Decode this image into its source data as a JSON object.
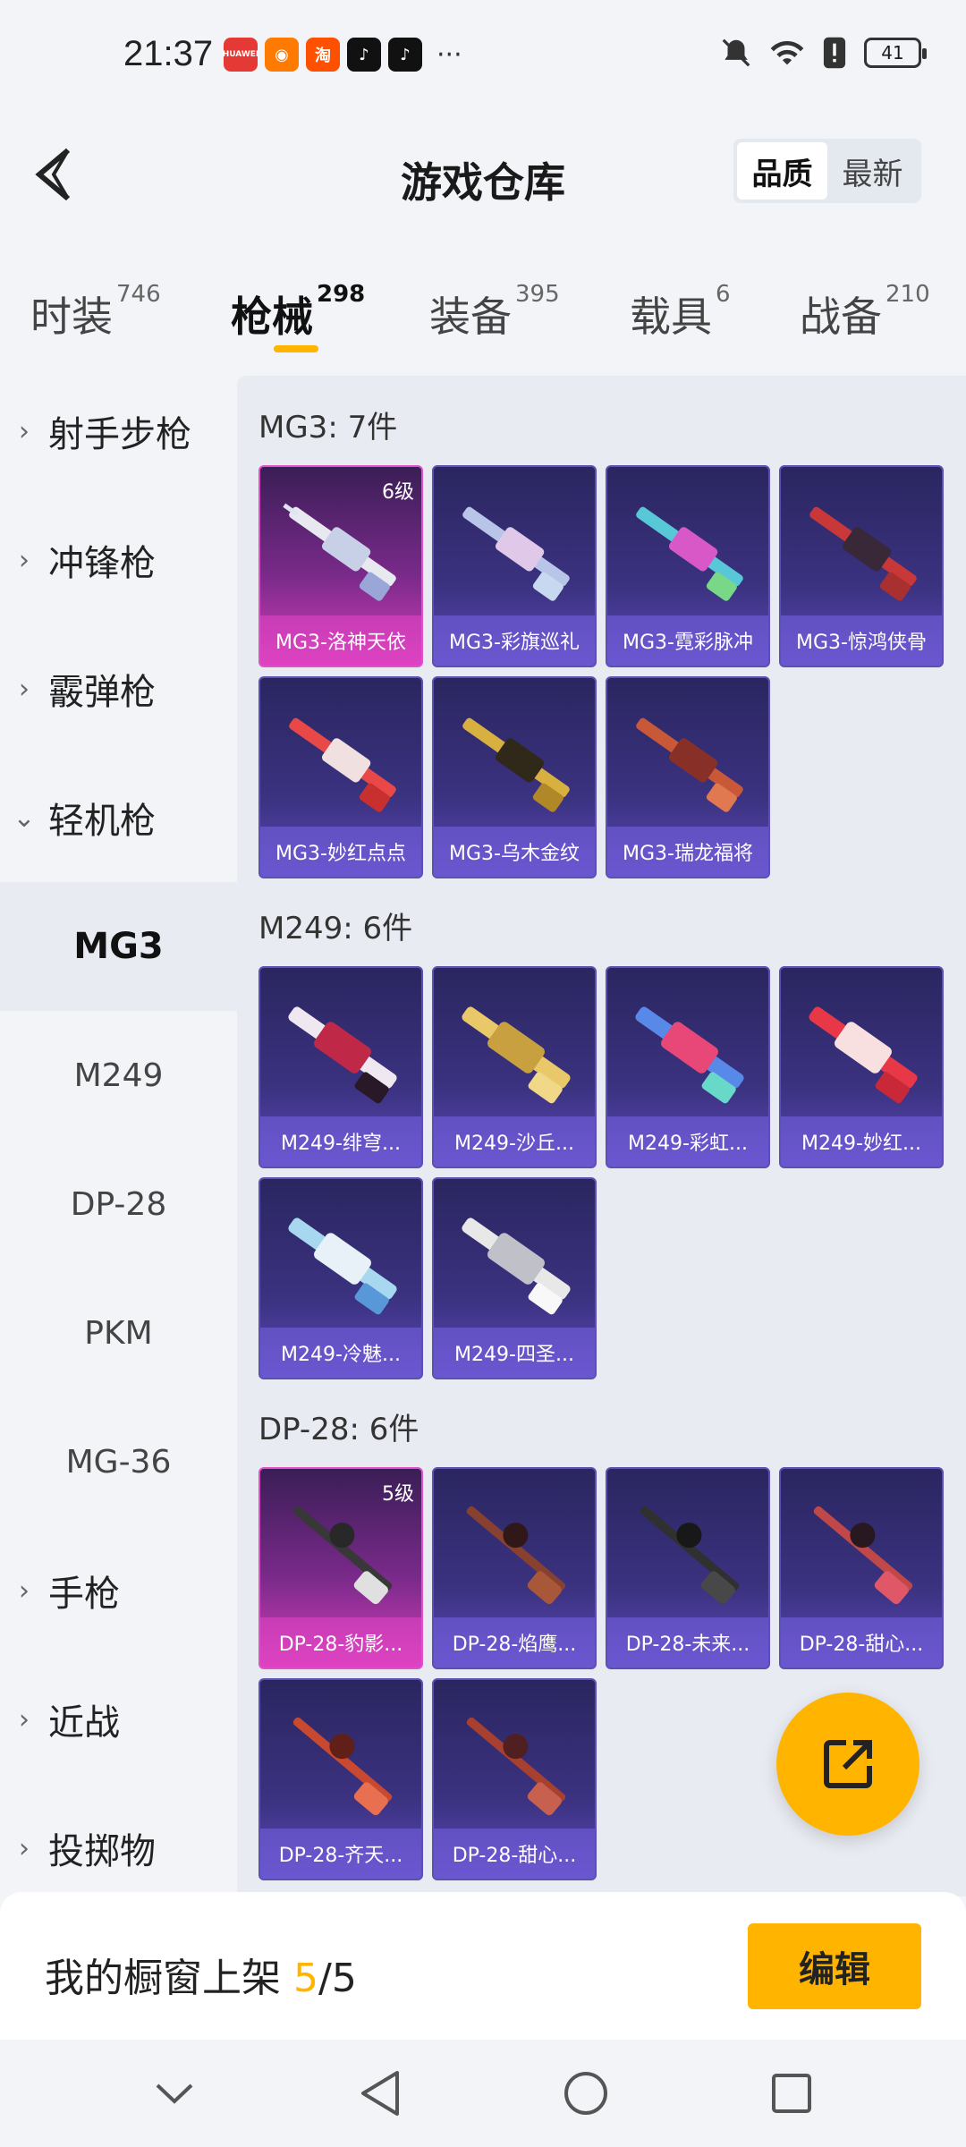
{
  "status_bar": {
    "time": "21:37",
    "apps": [
      {
        "label": "HUAWEI",
        "color": "#e53935"
      },
      {
        "label": "◉",
        "color": "#ff7a00"
      },
      {
        "label": "淘",
        "color": "#ff5000"
      },
      {
        "label": "♪",
        "color": "#111111"
      },
      {
        "label": "♪",
        "color": "#111111"
      }
    ],
    "more": "···",
    "battery": "41"
  },
  "header": {
    "title": "游戏仓库",
    "sort": {
      "quality": "品质",
      "latest": "最新"
    }
  },
  "tabs": [
    {
      "label": "时装",
      "count": "746"
    },
    {
      "label": "枪械",
      "count": "298"
    },
    {
      "label": "装备",
      "count": "395"
    },
    {
      "label": "载具",
      "count": "6"
    },
    {
      "label": "战备",
      "count": "210"
    }
  ],
  "sidebar": {
    "items": [
      {
        "label": "射手步枪",
        "chevron": "›"
      },
      {
        "label": "冲锋枪",
        "chevron": "›"
      },
      {
        "label": "霰弹枪",
        "chevron": "›"
      },
      {
        "label": "轻机枪",
        "chevron": "⌄"
      },
      {
        "label": "MG3"
      },
      {
        "label": "M249"
      },
      {
        "label": "DP-28"
      },
      {
        "label": "PKM"
      },
      {
        "label": "MG-36"
      },
      {
        "label": "手枪",
        "chevron": "›"
      },
      {
        "label": "近战",
        "chevron": "›"
      },
      {
        "label": "投掷物",
        "chevron": "›"
      }
    ]
  },
  "groups": [
    {
      "title": "MG3: 7件",
      "items": [
        {
          "name": "MG3-洛神天依",
          "level": "6级",
          "tier": "pink"
        },
        {
          "name": "MG3-彩旗巡礼"
        },
        {
          "name": "MG3-霓彩脉冲"
        },
        {
          "name": "MG3-惊鸿侠骨"
        },
        {
          "name": "MG3-妙红点点"
        },
        {
          "name": "MG3-乌木金纹"
        },
        {
          "name": "MG3-瑞龙福将"
        }
      ]
    },
    {
      "title": "M249: 6件",
      "items": [
        {
          "name": "M249-绯穹..."
        },
        {
          "name": "M249-沙丘..."
        },
        {
          "name": "M249-彩虹..."
        },
        {
          "name": "M249-妙红..."
        },
        {
          "name": "M249-冷魅..."
        },
        {
          "name": "M249-四圣..."
        }
      ]
    },
    {
      "title": "DP-28: 6件",
      "items": [
        {
          "name": "DP-28-豹影...",
          "level": "5级",
          "tier": "pink"
        },
        {
          "name": "DP-28-焰鹰..."
        },
        {
          "name": "DP-28-未来..."
        },
        {
          "name": "DP-28-甜心..."
        },
        {
          "name": "DP-28-齐天..."
        },
        {
          "name": "DP-28-甜心..."
        }
      ]
    }
  ],
  "showcase": {
    "label": "我的橱窗上架",
    "current": "5",
    "sep_total": "/5",
    "edit": "编辑"
  },
  "colors": {
    "accent": "#ffb400"
  }
}
